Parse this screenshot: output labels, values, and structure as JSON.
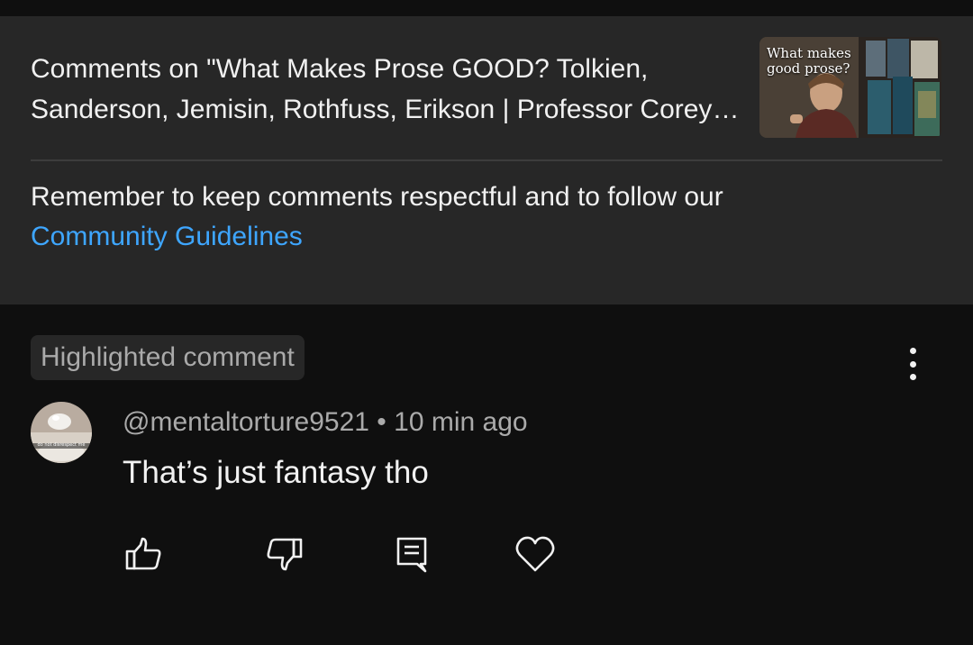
{
  "header": {
    "title": "Comments on \"What Makes Prose GOOD? Tolkien, Sanderson, Jemisin, Rothfuss, Erikson | Professor Corey Olsen\"",
    "thumbnail": {
      "overlay_line1": "What makes",
      "overlay_line2": "good prose?"
    }
  },
  "reminder": {
    "text": "Remember to keep comments respectful and to follow our ",
    "link_label": "Community Guidelines"
  },
  "comment": {
    "highlight_label": "Highlighted comment",
    "author": "@mentaltorture9521",
    "separator": " • ",
    "time": "10 min ago",
    "body": "That’s just fantasy tho",
    "avatar_caption": "do not disrespect me"
  },
  "actions": {
    "like_icon": "thumbs-up-icon",
    "dislike_icon": "thumbs-down-icon",
    "reply_icon": "comment-reply-icon",
    "heart_icon": "heart-icon"
  },
  "colors": {
    "background": "#0f0f0f",
    "panel": "#272727",
    "text_primary": "#f1f1f1",
    "text_secondary": "#aaaaaa",
    "link": "#3ea6ff"
  }
}
